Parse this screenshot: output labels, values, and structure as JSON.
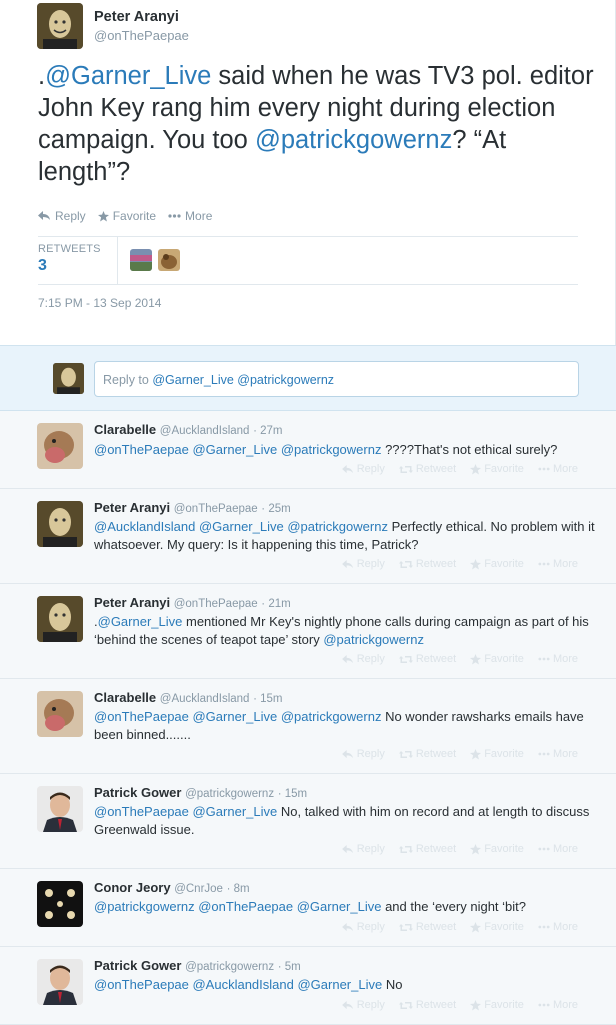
{
  "tweet": {
    "author_name": "Peter Aranyi",
    "author_handle": "@onThePaepae",
    "text_parts": [
      ".",
      "@Garner_Live",
      " said when he was TV3 pol. editor John Key rang him every night during election campaign. You too ",
      "@patrickgowernz",
      "? “At length”?"
    ],
    "actions": {
      "reply": "Reply",
      "favorite": "Favorite",
      "more": "More"
    },
    "retweets_label": "RETWEETS",
    "retweets_count": "3",
    "timestamp": "7:15 PM - 13 Sep 2014"
  },
  "reply_box": {
    "prefix": "Reply to ",
    "mentions": "@Garner_Live @patrickgowernz"
  },
  "reply_actions": {
    "reply": "Reply",
    "retweet": "Retweet",
    "favorite": "Favorite",
    "more": "More"
  },
  "replies": [
    {
      "name": "Clarabelle",
      "handle": "@AucklandIsland",
      "time": "· 27m",
      "mentions": "@onThePaepae @Garner_Live @patrickgowernz",
      "text": " ????That's not ethical surely?"
    },
    {
      "name": "Peter Aranyi",
      "handle": "@onThePaepae",
      "time": "· 25m",
      "mentions": "@AucklandIsland @Garner_Live @patrickgowernz",
      "text": " Perfectly ethical. No problem with it whatsoever. My query: Is it happening this time, Patrick?"
    },
    {
      "name": "Peter Aranyi",
      "handle": "@onThePaepae",
      "time": "· 21m",
      "prefix": ".",
      "mentions": "@Garner_Live",
      "text": " mentioned Mr Key's nightly phone calls during campaign as part of his ‘behind the scenes of teapot tape’ story ",
      "trail_mention": "@patrickgowernz"
    },
    {
      "name": "Clarabelle",
      "handle": "@AucklandIsland",
      "time": "· 15m",
      "mentions": "@onThePaepae @Garner_Live @patrickgowernz",
      "text": " No wonder rawsharks emails have been binned......."
    },
    {
      "name": "Patrick Gower",
      "handle": "@patrickgowernz",
      "time": "· 15m",
      "mentions": "@onThePaepae @Garner_Live",
      "text": " No, talked with him on record and at length to discuss Greenwald issue."
    },
    {
      "name": "Conor Jeory",
      "handle": "@CnrJoe",
      "time": "· 8m",
      "mentions": "@patrickgowernz @onThePaepae @Garner_Live",
      "text": " and the ‘every night ‘bit?"
    },
    {
      "name": "Patrick Gower",
      "handle": "@patrickgowernz",
      "time": "· 5m",
      "mentions": "@onThePaepae @AucklandIsland @Garner_Live",
      "text": " No"
    }
  ],
  "colors": {
    "link": "#2b7bb9",
    "muted": "#8899a6",
    "reply_bar": "#e8f3fb"
  },
  "icons": [
    "reply-icon",
    "star-icon",
    "more-icon",
    "retweet-icon"
  ]
}
